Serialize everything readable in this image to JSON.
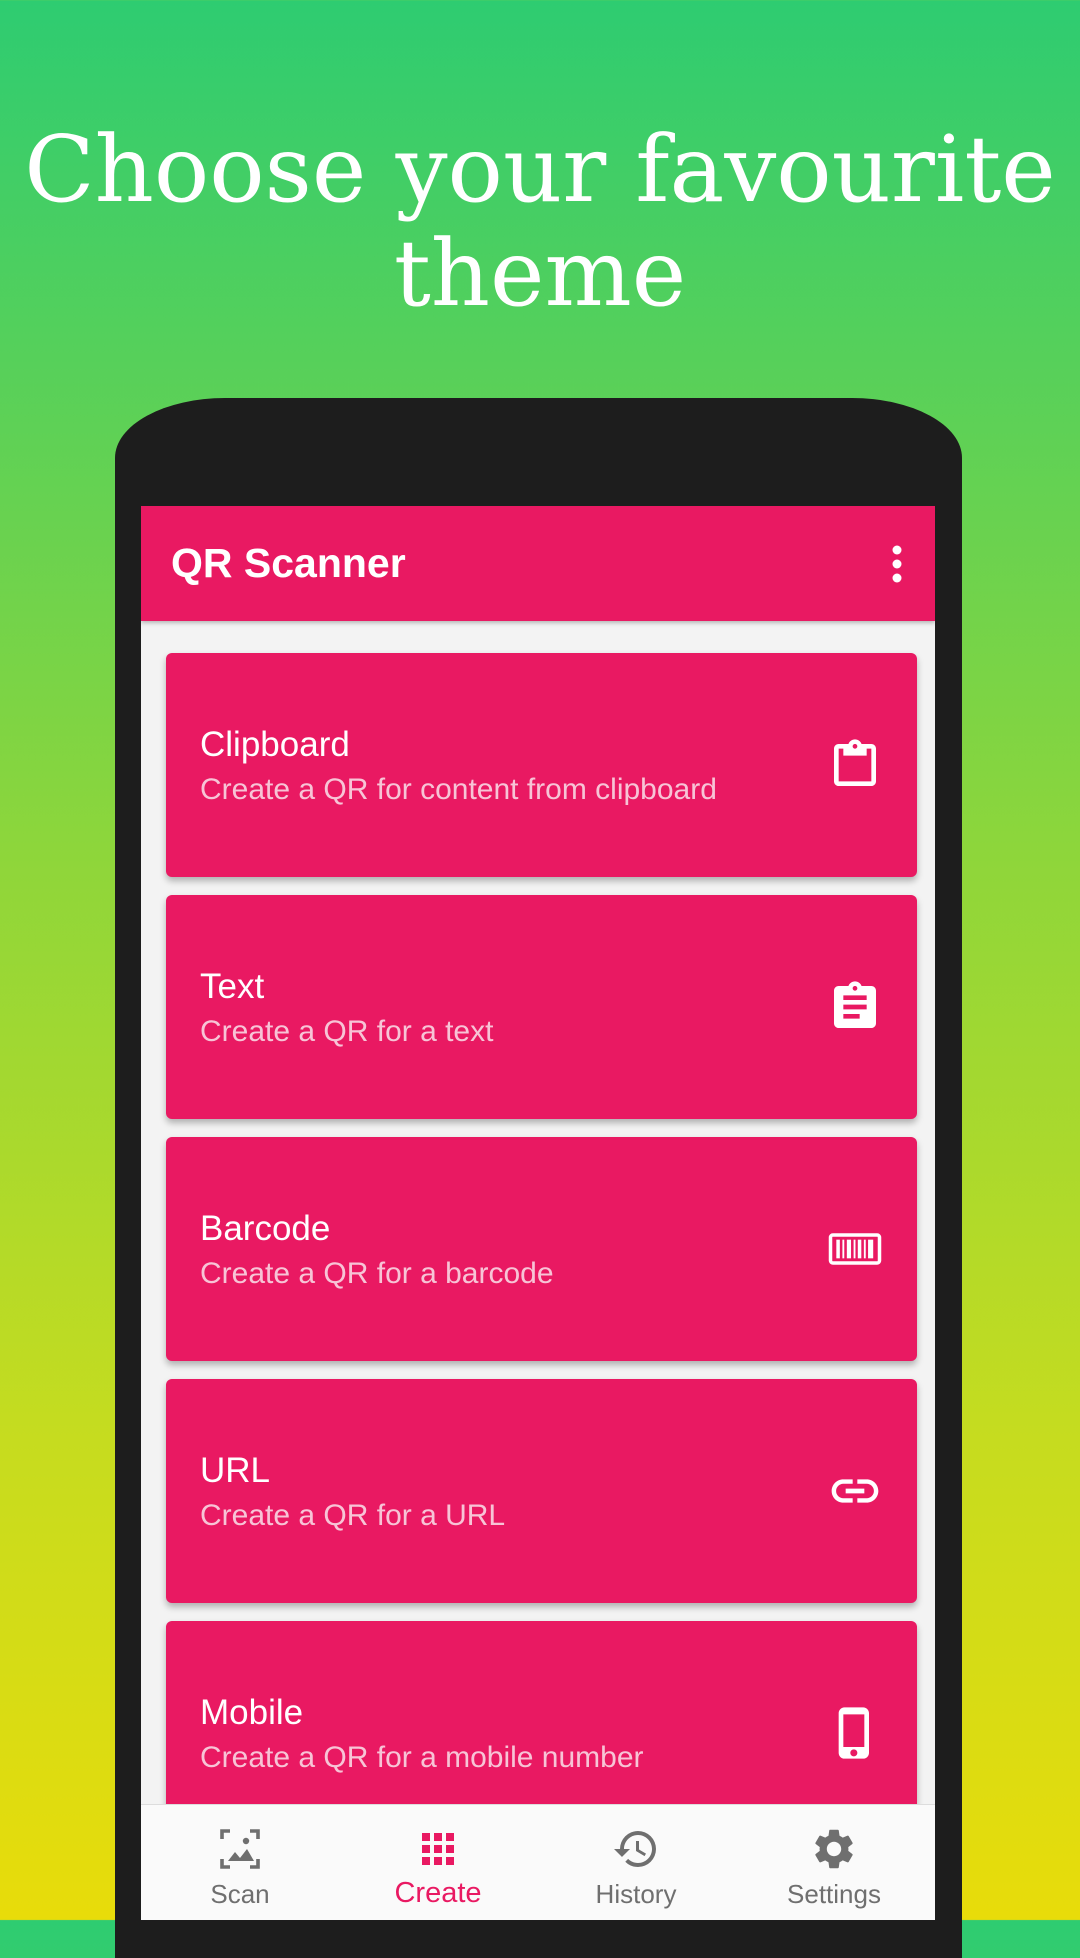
{
  "headline": {
    "line1": "Choose your favourite",
    "line2": "theme"
  },
  "app": {
    "title": "QR Scanner",
    "accent": "#e91962",
    "more_icon": "more-vert-icon"
  },
  "cards": [
    {
      "title": "Clipboard",
      "subtitle": "Create a QR for content from clipboard",
      "icon": "clipboard-icon"
    },
    {
      "title": "Text",
      "subtitle": "Create a QR for a text",
      "icon": "text-document-icon"
    },
    {
      "title": "Barcode",
      "subtitle": "Create a QR for a barcode",
      "icon": "barcode-icon"
    },
    {
      "title": "URL",
      "subtitle": "Create a QR for a URL",
      "icon": "link-icon"
    },
    {
      "title": "Mobile",
      "subtitle": "Create a QR for a mobile number",
      "icon": "phone-icon"
    }
  ],
  "nav": {
    "active": "Create",
    "items": [
      {
        "label": "Scan",
        "icon": "image-scan-icon"
      },
      {
        "label": "Create",
        "icon": "grid-icon"
      },
      {
        "label": "History",
        "icon": "history-icon"
      },
      {
        "label": "Settings",
        "icon": "gear-icon"
      }
    ]
  }
}
